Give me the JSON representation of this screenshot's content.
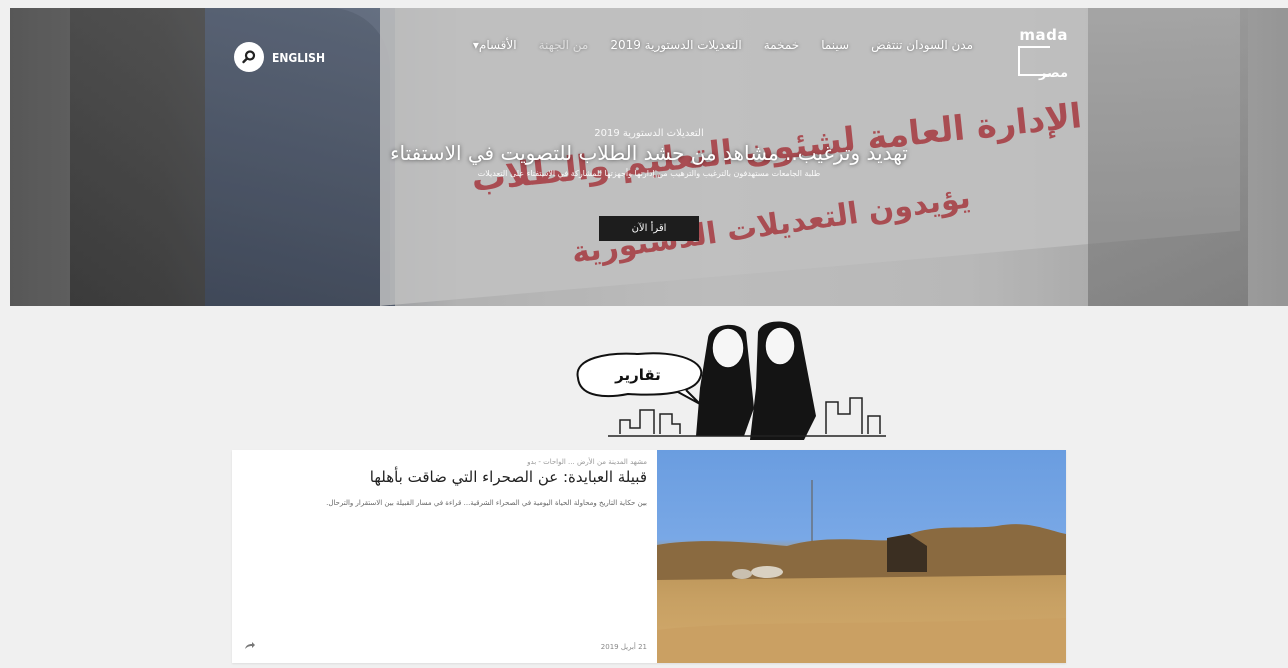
{
  "header": {
    "logo_top": "mada",
    "logo_bottom": "مصر",
    "menu": [
      "الأقسام",
      "من الجهنة",
      "التعديلات الدستورية 2019",
      "خمخمة",
      "سينما",
      "مدن السودان تنتفض"
    ],
    "english_label": "ENGLISH",
    "search_icon": "search-icon"
  },
  "hero": {
    "category": "التعديلات الدستورية 2019",
    "title": "تهديد وترغيب.. مشاهد من حشد الطلاب للتصويت في الاستفتاء",
    "subtitle": "طلبة الجامعات مستهدفون بالترغيب والترهيب من إدارتها وأجهزتها للمشاركة في الاستفتاء على التعديلات",
    "read_more": "اقرأ الآن",
    "banner_lines": [
      "الإدارة العامة لشئون التعليم والطلاب",
      "يؤيدون التعديلات الدستورية"
    ]
  },
  "section": {
    "label": "تقارير"
  },
  "card": {
    "tags": "مشهد المدينة من الأرض ... الواحات - بدو",
    "title": "قبيلة العبايدة: عن الصحراء التي ضاقت بأهلها",
    "excerpt": "بين حكاية التاريخ ومحاولة الحياة اليومية في الصحراء الشرقية... قراءة في مسار القبيلة بين الاستقرار والترحال.",
    "date": "21 أبريل 2019",
    "share_icon": "share-icon"
  },
  "colors": {
    "brand_red": "#c5232e",
    "button_bg": "#1d1d1d",
    "page_bg": "#f0f0f0",
    "card_bg": "#ffffff"
  }
}
